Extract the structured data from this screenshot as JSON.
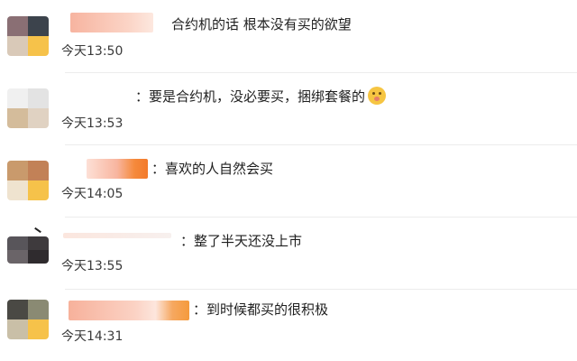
{
  "comments": [
    {
      "text": "合约机的话 根本没有买的欲望",
      "time": "今天13:50"
    },
    {
      "text": "：要是合约机，没必要买，捆绑套餐的",
      "time": "今天13:53",
      "emoji": "face-with-hand-over-mouth"
    },
    {
      "text": "：喜欢的人自然会买",
      "time": "今天14:05"
    },
    {
      "text": "：整了半天还没上市",
      "time": "今天13:55"
    },
    {
      "text": "：到时候都买的很积极",
      "time": "今天14:31"
    }
  ],
  "colors": {
    "text": "#1f1f1f",
    "time": "#3a3a3a",
    "name_blur": "#f6b8a4",
    "name_blur_accent": "#f58a3c"
  }
}
